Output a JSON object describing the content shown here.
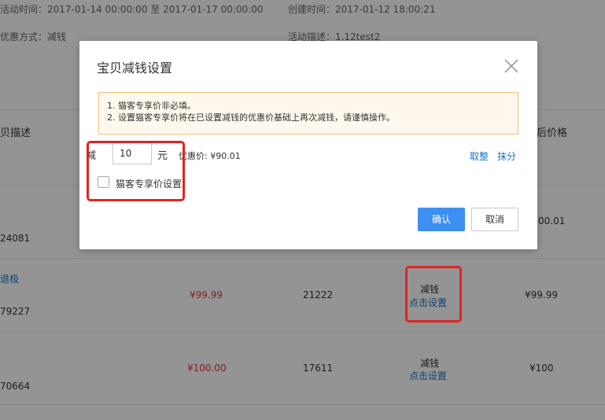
{
  "header": {
    "activity_time": "活动时间：2017-01-14 00:00:00 至 2017-01-17 00:00:00",
    "created_time": "创建时间：2017-01-12 18:00:21",
    "discount_method": "优惠方式：减钱",
    "activity_desc": "活动描述：1.12test2"
  },
  "table": {
    "col_desc": "贝描述",
    "col_after_price": "后价格",
    "rows": [
      {
        "id": "24081",
        "price": "",
        "stock": "",
        "action_type": "",
        "action_link": "",
        "final": "00.01"
      },
      {
        "title": "退极",
        "id": "79227",
        "price": "¥99.99",
        "stock": "21222",
        "action_type": "减钱",
        "action_link": "点击设置",
        "final": "¥99.99"
      },
      {
        "id": "70664",
        "price": "¥100.00",
        "stock": "17611",
        "action_type": "减钱",
        "action_link": "点击设置",
        "final": "¥100"
      }
    ]
  },
  "modal": {
    "title": "宝贝减钱设置",
    "notice_line1": "1. 猫客专享价非必填。",
    "notice_line2": "2. 设置猫客专享价将在已设置减钱的优惠价基础上再次减钱，请谨慎操作。",
    "minus_label": "减",
    "amount_value": "10",
    "unit_label": "元",
    "discount_price": "优惠价: ¥90.01",
    "round_link": "取整",
    "trim_link": "抹分",
    "exclusive_checkbox_label": "猫客专享价设置",
    "confirm_label": "确认",
    "cancel_label": "取消"
  },
  "colors": {
    "accent_blue": "#3d8ff1",
    "link_blue": "#1a73c9",
    "price_red": "#d9363e",
    "annotation_red": "#e02424",
    "notice_border": "#f3c27a",
    "notice_bg": "#fff8ee"
  },
  "icons": {
    "close": "close-icon"
  }
}
